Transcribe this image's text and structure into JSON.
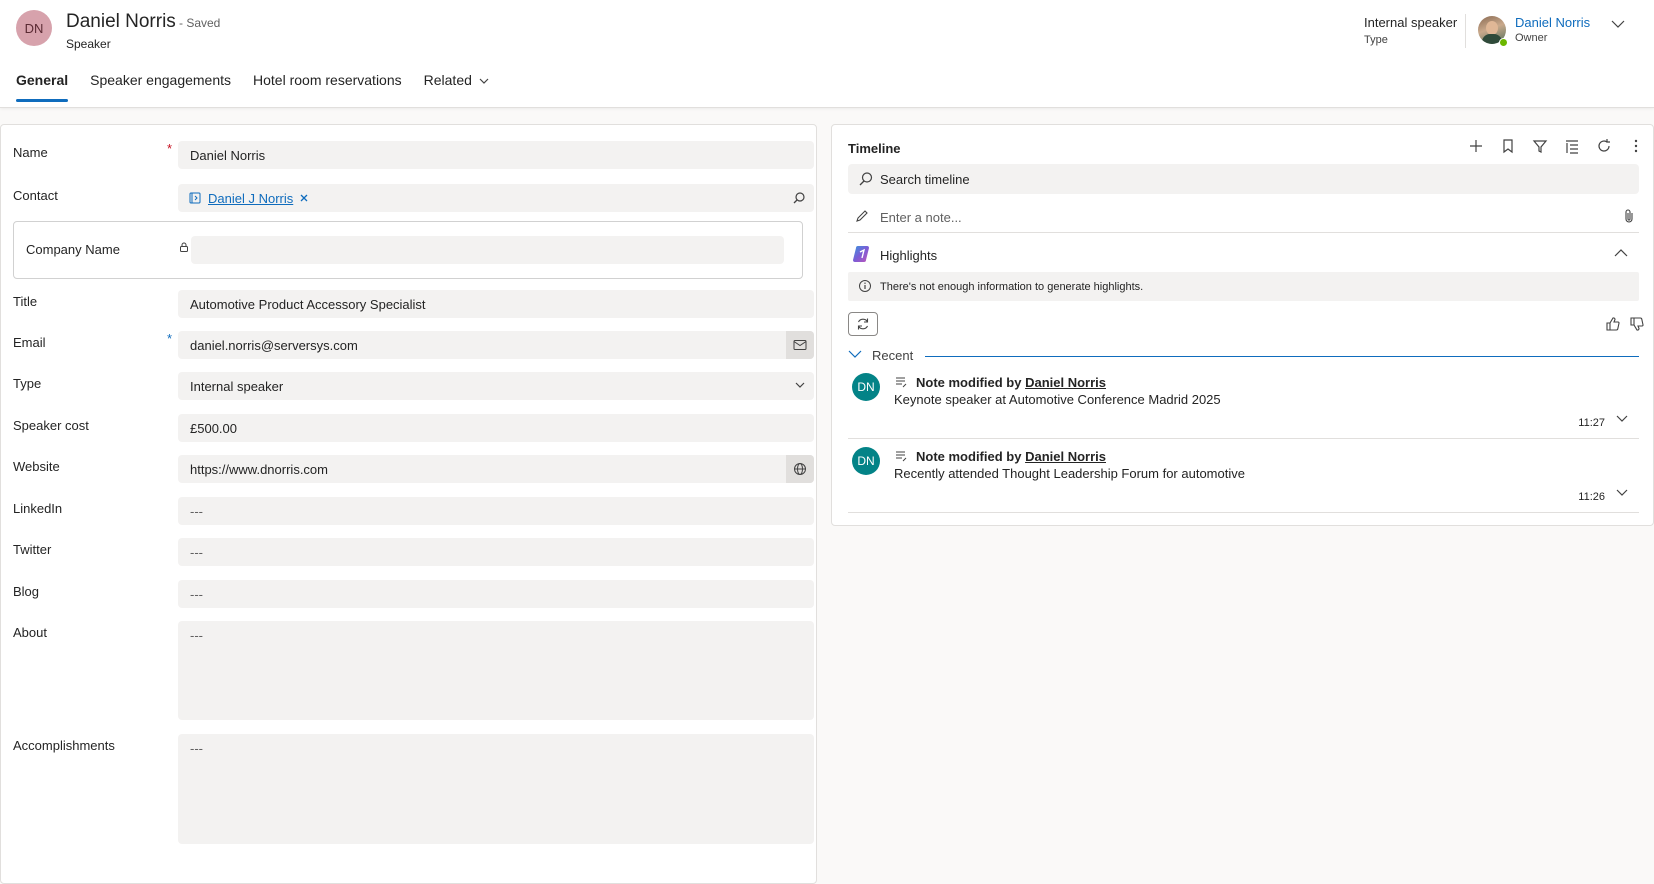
{
  "header": {
    "avatar_initials": "DN",
    "record_name": "Daniel Norris",
    "save_status": "- Saved",
    "entity_type": "Speaker",
    "type_value": "Internal speaker",
    "type_label": "Type",
    "owner_name": "Daniel Norris",
    "owner_label": "Owner"
  },
  "tabs": [
    {
      "label": "General",
      "active": true
    },
    {
      "label": "Speaker engagements"
    },
    {
      "label": "Hotel room reservations"
    },
    {
      "label": "Related"
    }
  ],
  "form": {
    "name": {
      "label": "Name",
      "required": "*",
      "value": "Daniel Norris"
    },
    "contact": {
      "label": "Contact",
      "value": "Daniel J Norris"
    },
    "company": {
      "label": "Company Name",
      "value": ""
    },
    "title": {
      "label": "Title",
      "value": "Automotive Product Accessory Specialist"
    },
    "email": {
      "label": "Email",
      "required": "*",
      "value": "daniel.norris@serversys.com"
    },
    "type": {
      "label": "Type",
      "value": "Internal speaker"
    },
    "cost": {
      "label": "Speaker cost",
      "value": "£500.00"
    },
    "website": {
      "label": "Website",
      "value": "https://www.dnorris.com"
    },
    "linkedin": {
      "label": "LinkedIn",
      "value": "---"
    },
    "twitter": {
      "label": "Twitter",
      "value": "---"
    },
    "blog": {
      "label": "Blog",
      "value": "---"
    },
    "about": {
      "label": "About",
      "value": "---"
    },
    "accomplishments": {
      "label": "Accomplishments",
      "value": "---"
    }
  },
  "timeline": {
    "title": "Timeline",
    "search_placeholder": "Search timeline",
    "note_placeholder": "Enter a note...",
    "highlights_label": "Highlights",
    "highlights_info": "There's not enough information to generate highlights.",
    "recent_label": "Recent",
    "items": [
      {
        "initials": "DN",
        "action": "Note modified by",
        "by": "Daniel Norris",
        "text": "Keynote speaker at Automotive Conference Madrid 2025",
        "time": "11:27"
      },
      {
        "initials": "DN",
        "action": "Note modified by",
        "by": "Daniel Norris",
        "text": "Recently attended Thought Leadership Forum for automotive",
        "time": "11:26"
      }
    ]
  },
  "colors": {
    "accent": "#0f6cbd",
    "avatar_record": "#d7a2ac",
    "avatar_timeline": "#038387",
    "required": "#c50f1f",
    "presence": "#6bb700"
  },
  "icons": [
    "chevron-down-icon",
    "contact-card-icon",
    "close-icon",
    "search-icon",
    "lock-icon",
    "mail-icon",
    "globe-icon",
    "add-icon",
    "bookmark-icon",
    "filter-icon",
    "sort-icon",
    "refresh-icon",
    "more-icon",
    "pencil-icon",
    "attach-icon",
    "copilot-icon",
    "chevron-up-icon",
    "info-icon",
    "thumbs-up-icon",
    "thumbs-down-icon",
    "note-icon"
  ]
}
